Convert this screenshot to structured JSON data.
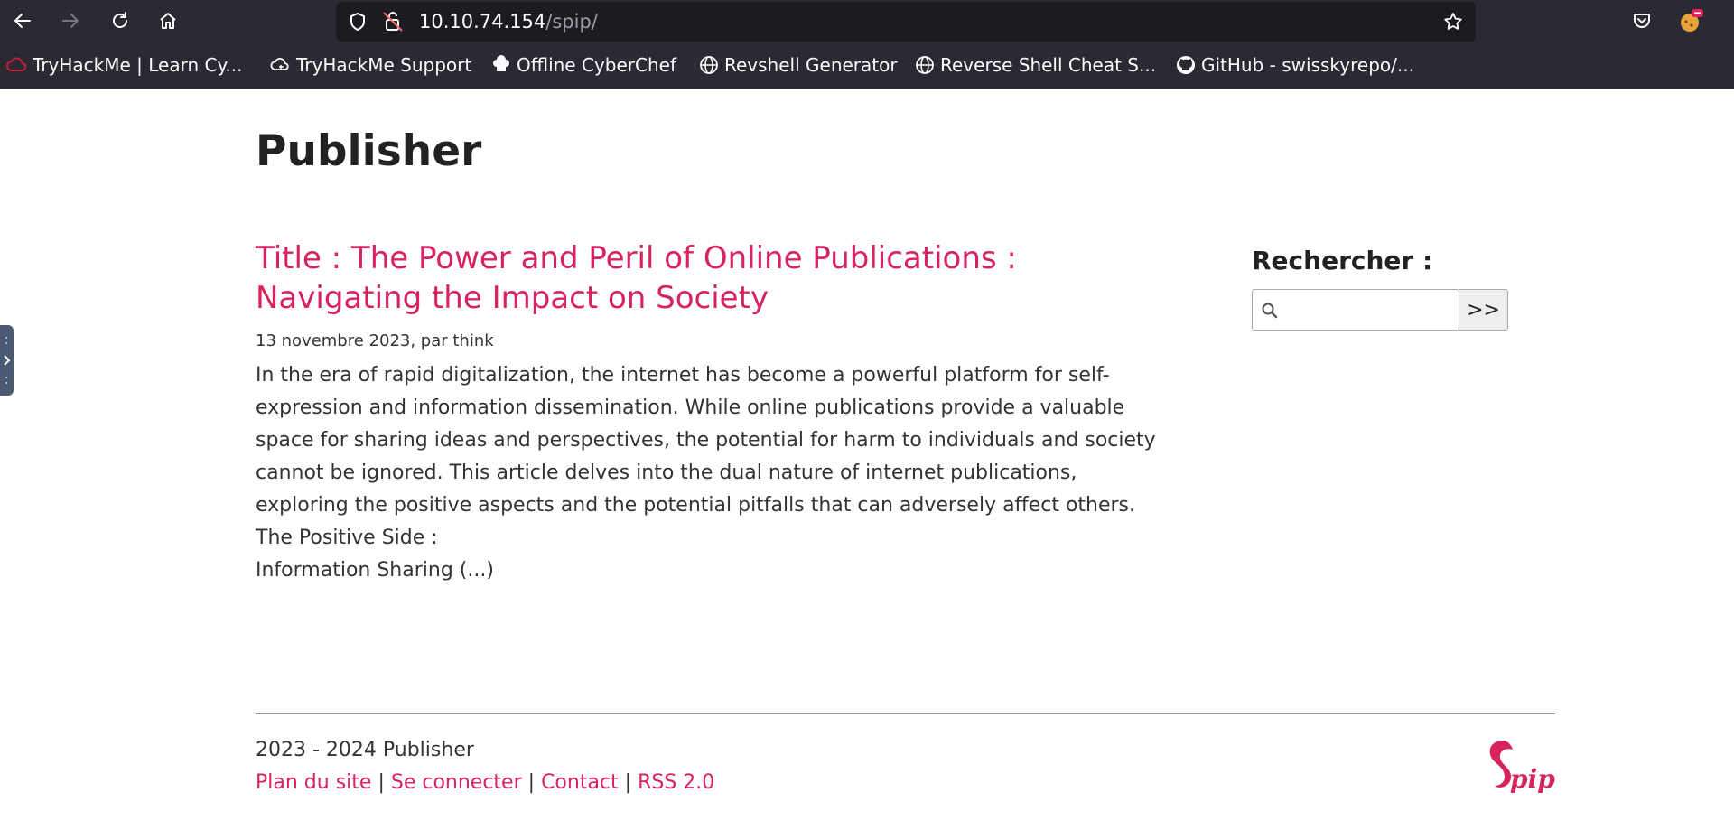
{
  "browser": {
    "url_host": "10.10.74.154",
    "url_path": "/spip/",
    "bookmarks": [
      {
        "label": "TryHackMe | Learn Cy...",
        "icon": "tryhackme-icon"
      },
      {
        "label": "TryHackMe Support",
        "icon": "cloud-icon"
      },
      {
        "label": "Offline CyberChef",
        "icon": "chef-hat-icon"
      },
      {
        "label": "Revshell Generator",
        "icon": "globe-icon"
      },
      {
        "label": "Reverse Shell Cheat S...",
        "icon": "globe-icon"
      },
      {
        "label": "GitHub - swisskyrepo/...",
        "icon": "github-icon"
      }
    ]
  },
  "site": {
    "title": "Publisher"
  },
  "article": {
    "title": "Title : The Power and Peril of Online Publications : Navigating the Impact on Society",
    "meta": "13 novembre 2023, par think",
    "intro": "In the era of rapid digitalization, the internet has become a powerful platform for self-expression and information dissemination. While online publications provide a valuable space for sharing ideas and perspectives, the potential for harm to individuals and society cannot be ignored. This article delves into the dual nature of internet publications, exploring the positive aspects and the potential pitfalls that can adversely affect others.",
    "subheading": "The Positive Side :",
    "teaser": "Information Sharing (...)"
  },
  "search": {
    "heading": "Rechercher :",
    "value": "",
    "button_label": ">>"
  },
  "footer": {
    "copyright": "2023 - 2024 Publisher",
    "links": [
      "Plan du site",
      "Se connecter",
      "Contact",
      "RSS 2.0"
    ],
    "separator": "|",
    "logo_text": "pip"
  },
  "colors": {
    "accent": "#d7245c",
    "chrome": "#2b2a33",
    "urlbar": "#1c1b22"
  }
}
